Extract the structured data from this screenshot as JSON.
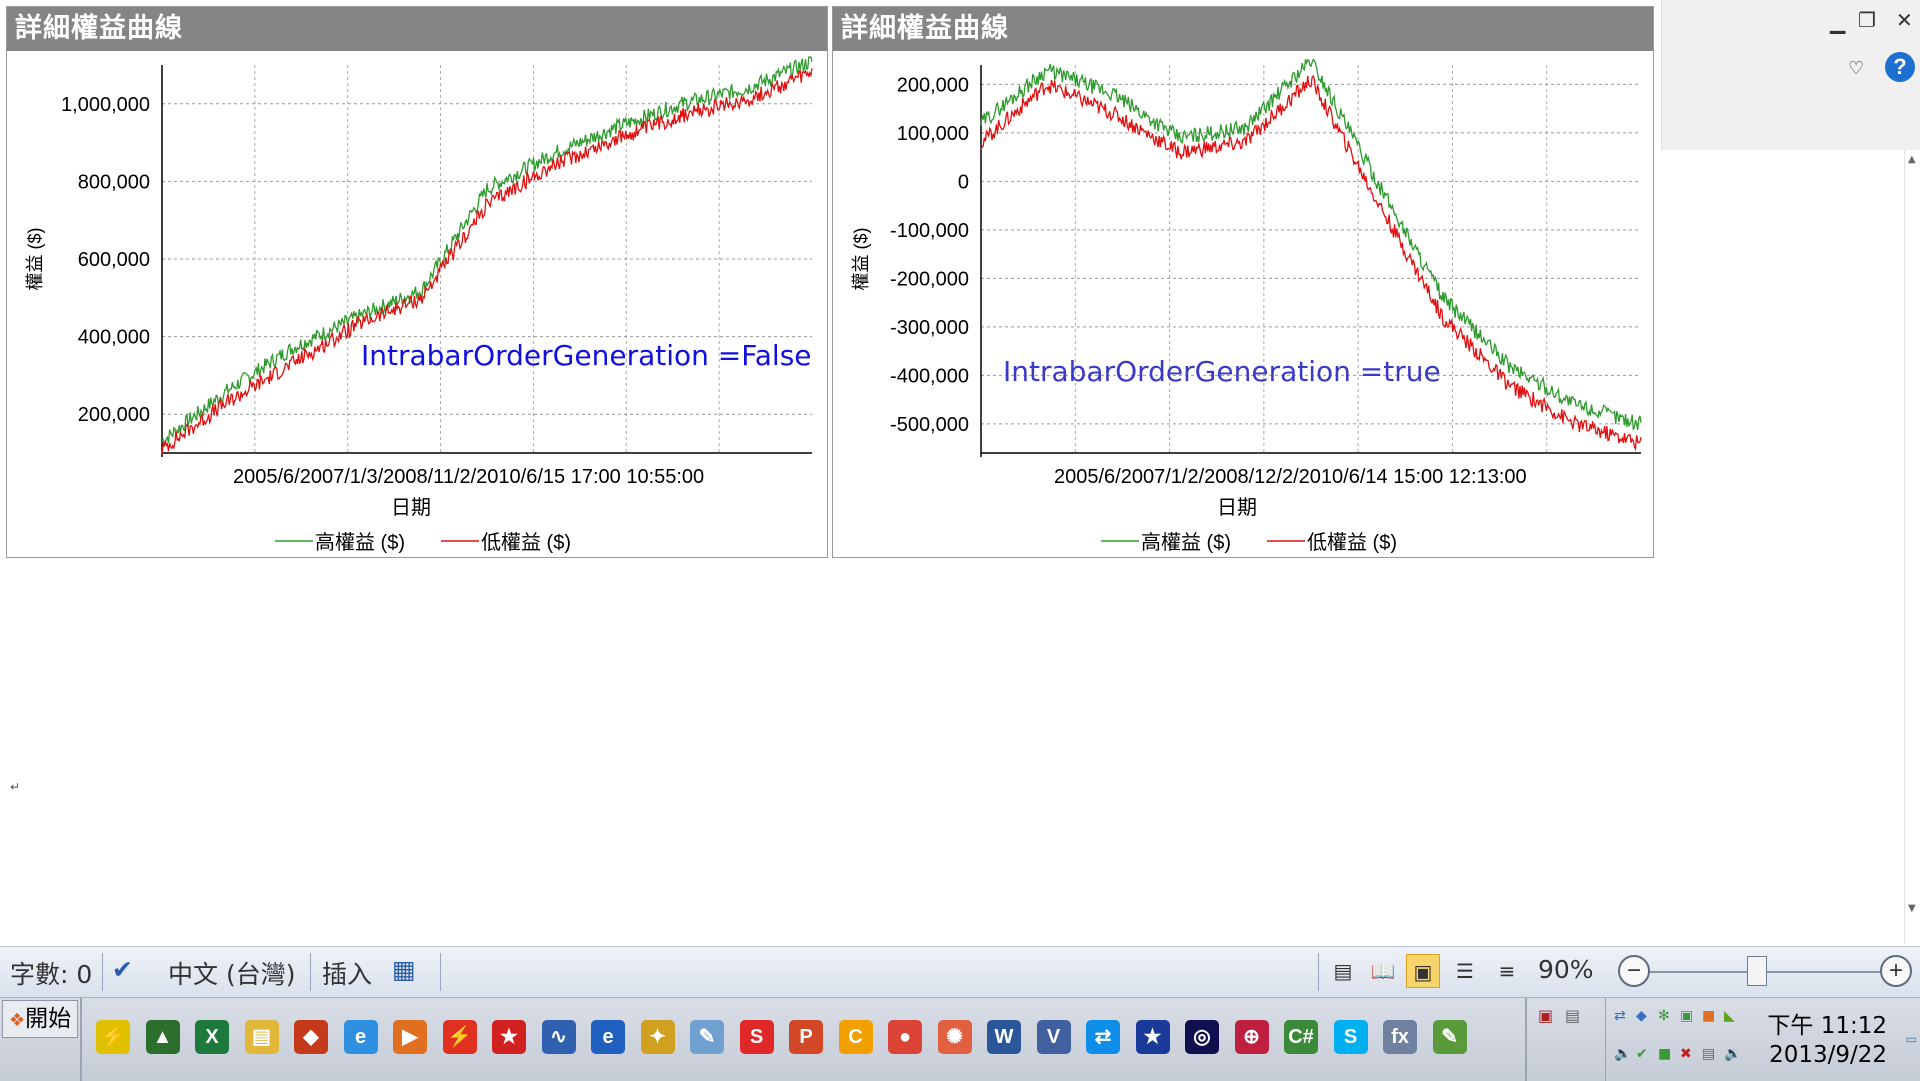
{
  "panels": [
    {
      "title": "詳細權益曲線",
      "annotation": "IntrabarOrderGeneration  =False",
      "annotation_color": "#1010e0"
    },
    {
      "title": "詳細權益曲線",
      "annotation": "IntrabarOrderGeneration  =true",
      "annotation_color": "#3a3ac8"
    }
  ],
  "chart_data": [
    {
      "type": "line",
      "ylabel": "權益 ($)",
      "xlabel": "日期",
      "ylim": [
        100000,
        1100000
      ],
      "yticks": [
        "200,000",
        "400,000",
        "600,000",
        "800,000",
        "1,000,000"
      ],
      "ytick_values": [
        200000,
        400000,
        600000,
        800000,
        1000000
      ],
      "xtick_text": "2005/6/2007/1/3/2008/11/2/2010/6/15 17:00 10:55:00",
      "x": [
        0,
        0.1,
        0.2,
        0.3,
        0.4,
        0.5,
        0.6,
        0.7,
        0.8,
        0.9,
        1.0
      ],
      "series": [
        {
          "name": "高權益 ($)",
          "color": "#2e9a2e",
          "values": [
            130000,
            260000,
            370000,
            450000,
            520000,
            780000,
            870000,
            940000,
            1000000,
            1040000,
            1110000
          ]
        },
        {
          "name": "低權益 ($)",
          "color": "#e01010",
          "values": [
            110000,
            230000,
            330000,
            430000,
            500000,
            740000,
            840000,
            910000,
            970000,
            1010000,
            1080000
          ]
        }
      ],
      "legend": "bottom",
      "grid": true
    },
    {
      "type": "line",
      "ylabel": "權益 ($)",
      "xlabel": "日期",
      "ylim": [
        -560000,
        240000
      ],
      "yticks": [
        "200,000",
        "100,000",
        "0",
        "-100,000",
        "-200,000",
        "-300,000",
        "-400,000",
        "-500,000"
      ],
      "ytick_values": [
        200000,
        100000,
        0,
        -100000,
        -200000,
        -300000,
        -400000,
        -500000
      ],
      "xtick_text": "2005/6/2007/1/2/2008/12/2/2010/6/14 15:00 12:13:00",
      "x": [
        0,
        0.1,
        0.2,
        0.3,
        0.4,
        0.5,
        0.6,
        0.7,
        0.8,
        0.9,
        1.0
      ],
      "series": [
        {
          "name": "高權益 ($)",
          "color": "#2e9a2e",
          "values": [
            120000,
            230000,
            180000,
            90000,
            110000,
            250000,
            0,
            -240000,
            -380000,
            -460000,
            -500000
          ]
        },
        {
          "name": "低權益 ($)",
          "color": "#e01010",
          "values": [
            80000,
            200000,
            140000,
            60000,
            80000,
            210000,
            -40000,
            -280000,
            -420000,
            -500000,
            -540000
          ]
        }
      ],
      "legend": "bottom",
      "grid": true
    }
  ],
  "window": {
    "minimize_icon": "minimize-icon",
    "restore_icon": "restore-icon",
    "close_icon": "close-icon",
    "help_label": "?"
  },
  "statusbar": {
    "word_count": "字數: 0",
    "language": "中文 (台灣)",
    "mode": "插入",
    "zoom": "90%",
    "zoom_minus": "−",
    "zoom_plus": "+"
  },
  "taskbar": {
    "start_label": "開始",
    "clock_time": "下午 11:12",
    "clock_date": "2013/9/22",
    "apps": [
      {
        "name": "flash-icon",
        "color": "#e0c000"
      },
      {
        "name": "stock-chart-icon",
        "color": "#2c6e2c"
      },
      {
        "name": "excel-icon",
        "color": "#1e7a3c"
      },
      {
        "name": "folder-icon",
        "color": "#e2b83a"
      },
      {
        "name": "cube-icon",
        "color": "#c43a1a"
      },
      {
        "name": "ie-icon",
        "color": "#2f8fe0"
      },
      {
        "name": "media-player-icon",
        "color": "#e07020"
      },
      {
        "name": "lightning-icon",
        "color": "#e03020"
      },
      {
        "name": "new-app-icon",
        "color": "#d02020"
      },
      {
        "name": "chart-app-icon",
        "color": "#3060b0"
      },
      {
        "name": "edge-icon",
        "color": "#1f5fbf"
      },
      {
        "name": "puzzle-icon",
        "color": "#d0a020"
      },
      {
        "name": "paint-icon",
        "color": "#70a0d0"
      },
      {
        "name": "dollar-icon",
        "color": "#e02828"
      },
      {
        "name": "powerpoint-icon",
        "color": "#d24726"
      },
      {
        "name": "c-app-icon",
        "color": "#f2a000"
      },
      {
        "name": "chrome-icon",
        "color": "#db4437"
      },
      {
        "name": "pinwheel-icon",
        "color": "#e06040"
      },
      {
        "name": "word-icon",
        "color": "#2b579a"
      },
      {
        "name": "vb-icon",
        "color": "#4060a0"
      },
      {
        "name": "teamviewer-icon",
        "color": "#0e8ee9"
      },
      {
        "name": "star-icon",
        "color": "#1a3a9a"
      },
      {
        "name": "concord-icon",
        "color": "#101050"
      },
      {
        "name": "globe-icon",
        "color": "#c02040"
      },
      {
        "name": "csharp-icon",
        "color": "#3a8a3a"
      },
      {
        "name": "skype-icon",
        "color": "#00aff0"
      },
      {
        "name": "fx-icon",
        "color": "#7080a0"
      },
      {
        "name": "evernote-icon",
        "color": "#5a9a3a"
      }
    ],
    "app_glyphs": [
      "⚡",
      "▲",
      "X",
      "▤",
      "◆",
      "e",
      "▶",
      "⚡",
      "★",
      "∿",
      "e",
      "✦",
      "✎",
      "S",
      "P",
      "C",
      "●",
      "✺",
      "W",
      "V",
      "⇄",
      "★",
      "◎",
      "⊕",
      "C#",
      "S",
      "fx",
      "✎"
    ]
  }
}
